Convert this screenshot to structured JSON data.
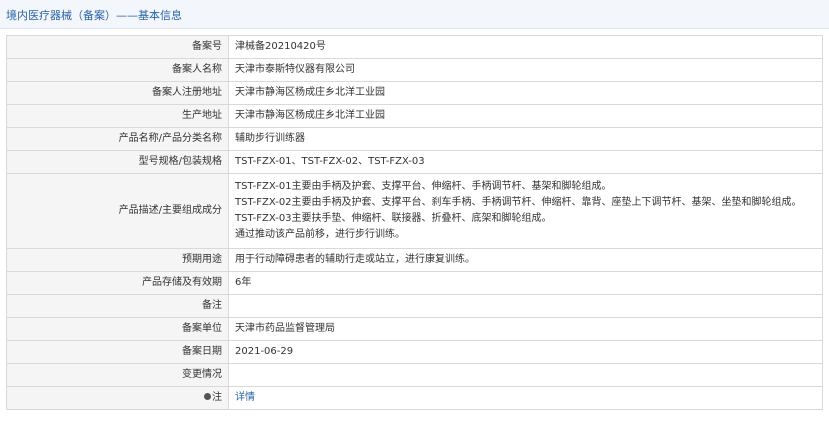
{
  "header": {
    "title": "境内医疗器械（备案）——基本信息"
  },
  "rows": {
    "r1": {
      "label": "备案号",
      "value": "津械备20210420号"
    },
    "r2": {
      "label": "备案人名称",
      "value": "天津市泰斯特仪器有限公司"
    },
    "r3": {
      "label": "备案人注册地址",
      "value": "天津市静海区杨成庄乡北洋工业园"
    },
    "r4": {
      "label": "生产地址",
      "value": "天津市静海区杨成庄乡北洋工业园"
    },
    "r5": {
      "label": "产品名称/产品分类名称",
      "value": "辅助步行训练器"
    },
    "r6": {
      "label": "型号规格/包装规格",
      "value": "TST-FZX-01、TST-FZX-02、TST-FZX-03"
    },
    "r7": {
      "label": "产品描述/主要组成成分",
      "lines": [
        "TST-FZX-01主要由手柄及护套、支撑平台、伸缩杆、手柄调节杆、基架和脚轮组成。",
        "TST-FZX-02主要由手柄及护套、支撑平台、刹车手柄、手柄调节杆、伸缩杆、靠背、座垫上下调节杆、基架、坐垫和脚轮组成。",
        "TST-FZX-03主要扶手垫、伸缩杆、联接器、折叠杆、底架和脚轮组成。",
        "通过推动该产品前移，进行步行训练。"
      ]
    },
    "r8": {
      "label": "预期用途",
      "value": "用于行动障碍患者的辅助行走或站立，进行康复训练。"
    },
    "r9": {
      "label": "产品存储及有效期",
      "value": "6年"
    },
    "r10": {
      "label": "备注",
      "value": ""
    },
    "r11": {
      "label": "备案单位",
      "value": "天津市药品监督管理局"
    },
    "r12": {
      "label": "备案日期",
      "value": "2021-06-29"
    },
    "r13": {
      "label": "变更情况",
      "value": ""
    },
    "r14": {
      "label": "注",
      "value": "详情",
      "icon": "info-bulb-icon"
    }
  }
}
